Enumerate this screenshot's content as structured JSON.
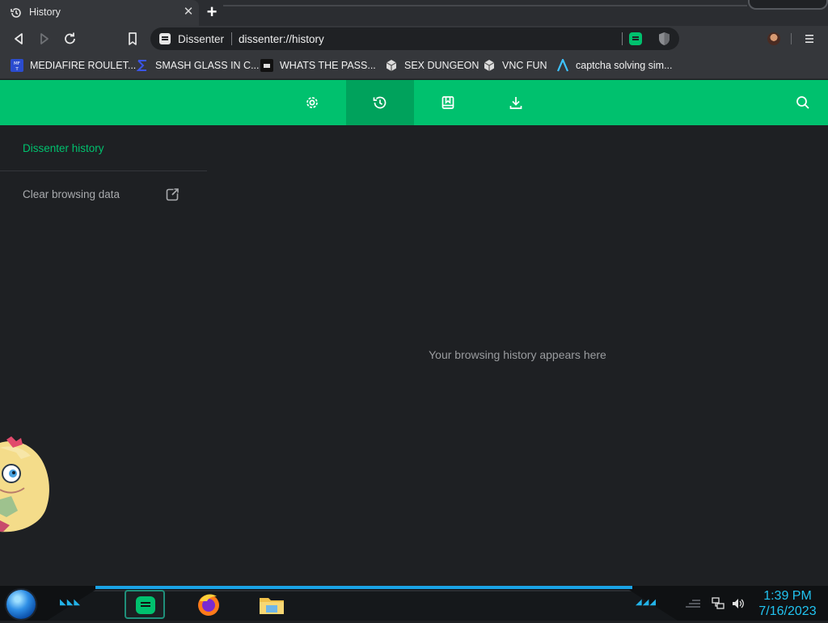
{
  "tab": {
    "title": "History",
    "close": "✕",
    "new_tab": "+"
  },
  "toolbar": {
    "site_name": "Dissenter",
    "url": "dissenter://history"
  },
  "bookmarks": [
    {
      "label": "MEDIAFIRE ROULET...",
      "icon": "mediafire-icon"
    },
    {
      "label": "SMASH GLASS IN C...",
      "icon": "sigma-icon"
    },
    {
      "label": "WHATS THE PASS...",
      "icon": "terminal-icon"
    },
    {
      "label": "SEX DUNGEON",
      "icon": "cube-icon"
    },
    {
      "label": "VNC FUN",
      "icon": "cube-icon"
    },
    {
      "label": "captcha solving sim...",
      "icon": "arrow-up-icon"
    }
  ],
  "header": {
    "buttons": [
      "settings-icon",
      "history-icon",
      "bookmarks-icon",
      "downloads-icon"
    ],
    "active": "history-icon"
  },
  "sidebar": {
    "title": "Dissenter history",
    "clear_label": "Clear browsing data"
  },
  "main": {
    "empty_message": "Your browsing history appears here"
  },
  "taskbar": {
    "time": "1:39 PM",
    "date": "7/16/2023"
  },
  "colors": {
    "accent": "#00c16e",
    "accent_active": "#00a25c",
    "page_bg": "#1e2023",
    "clock": "#21c3f0"
  }
}
